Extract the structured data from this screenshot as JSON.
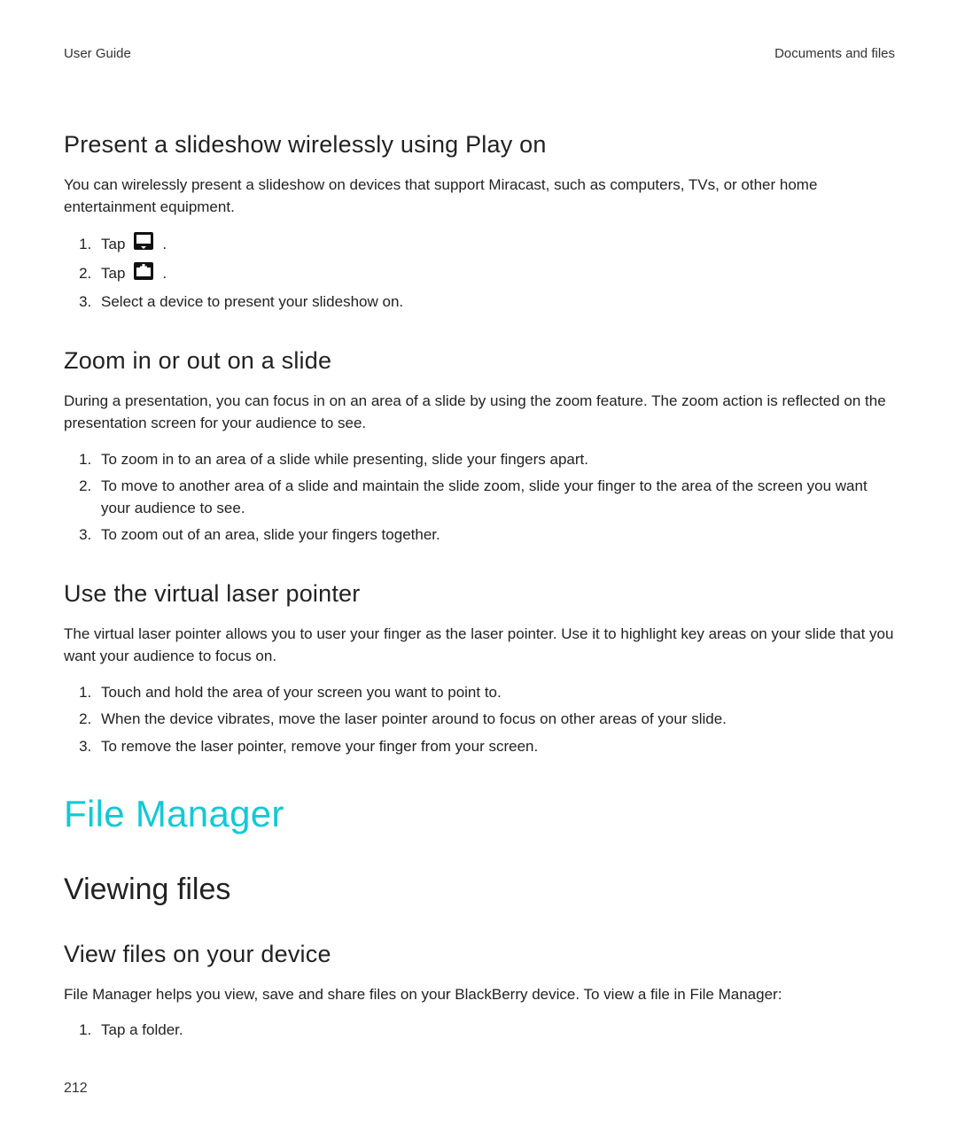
{
  "header": {
    "left": "User Guide",
    "right": "Documents and files"
  },
  "section_present": {
    "heading": "Present a slideshow wirelessly using Play on",
    "intro": "You can wirelessly present a slideshow on devices that support Miracast, such as computers, TVs, or other home entertainment equipment.",
    "steps": {
      "s1_pre": "Tap ",
      "s1_post": " .",
      "s2_pre": "Tap ",
      "s2_post": " .",
      "s3": "Select a device to present your slideshow on."
    },
    "icons": {
      "screen": "screen-share-icon",
      "playon": "play-on-add-icon"
    }
  },
  "section_zoom": {
    "heading": "Zoom in or out on a slide",
    "intro": "During a presentation, you can focus in on an area of a slide by using the zoom feature. The zoom action is reflected on the presentation screen for your audience to see.",
    "steps": {
      "s1": "To zoom in to an area of a slide while presenting, slide your fingers apart.",
      "s2": "To move to another area of a slide and maintain the slide zoom, slide your finger to the area of the screen you want your audience to see.",
      "s3": "To zoom out of an area, slide your fingers together."
    }
  },
  "section_laser": {
    "heading": "Use the virtual laser pointer",
    "intro": "The virtual laser pointer allows you to user your finger as the laser pointer. Use it to highlight key areas on your slide that you want your audience to focus on.",
    "steps": {
      "s1": "Touch and hold the area of your screen you want to point to.",
      "s2": "When the device vibrates, move the laser pointer around to focus on other areas of your slide.",
      "s3": "To remove the laser pointer, remove your finger from your screen."
    }
  },
  "module_heading": "File Manager",
  "subsection_heading": "Viewing files",
  "section_viewfiles": {
    "heading": "View files on your device",
    "intro": "File Manager helps you view, save and share files on your BlackBerry device. To view a file in File Manager:",
    "steps": {
      "s1": "Tap a folder."
    }
  },
  "page_number": "212"
}
